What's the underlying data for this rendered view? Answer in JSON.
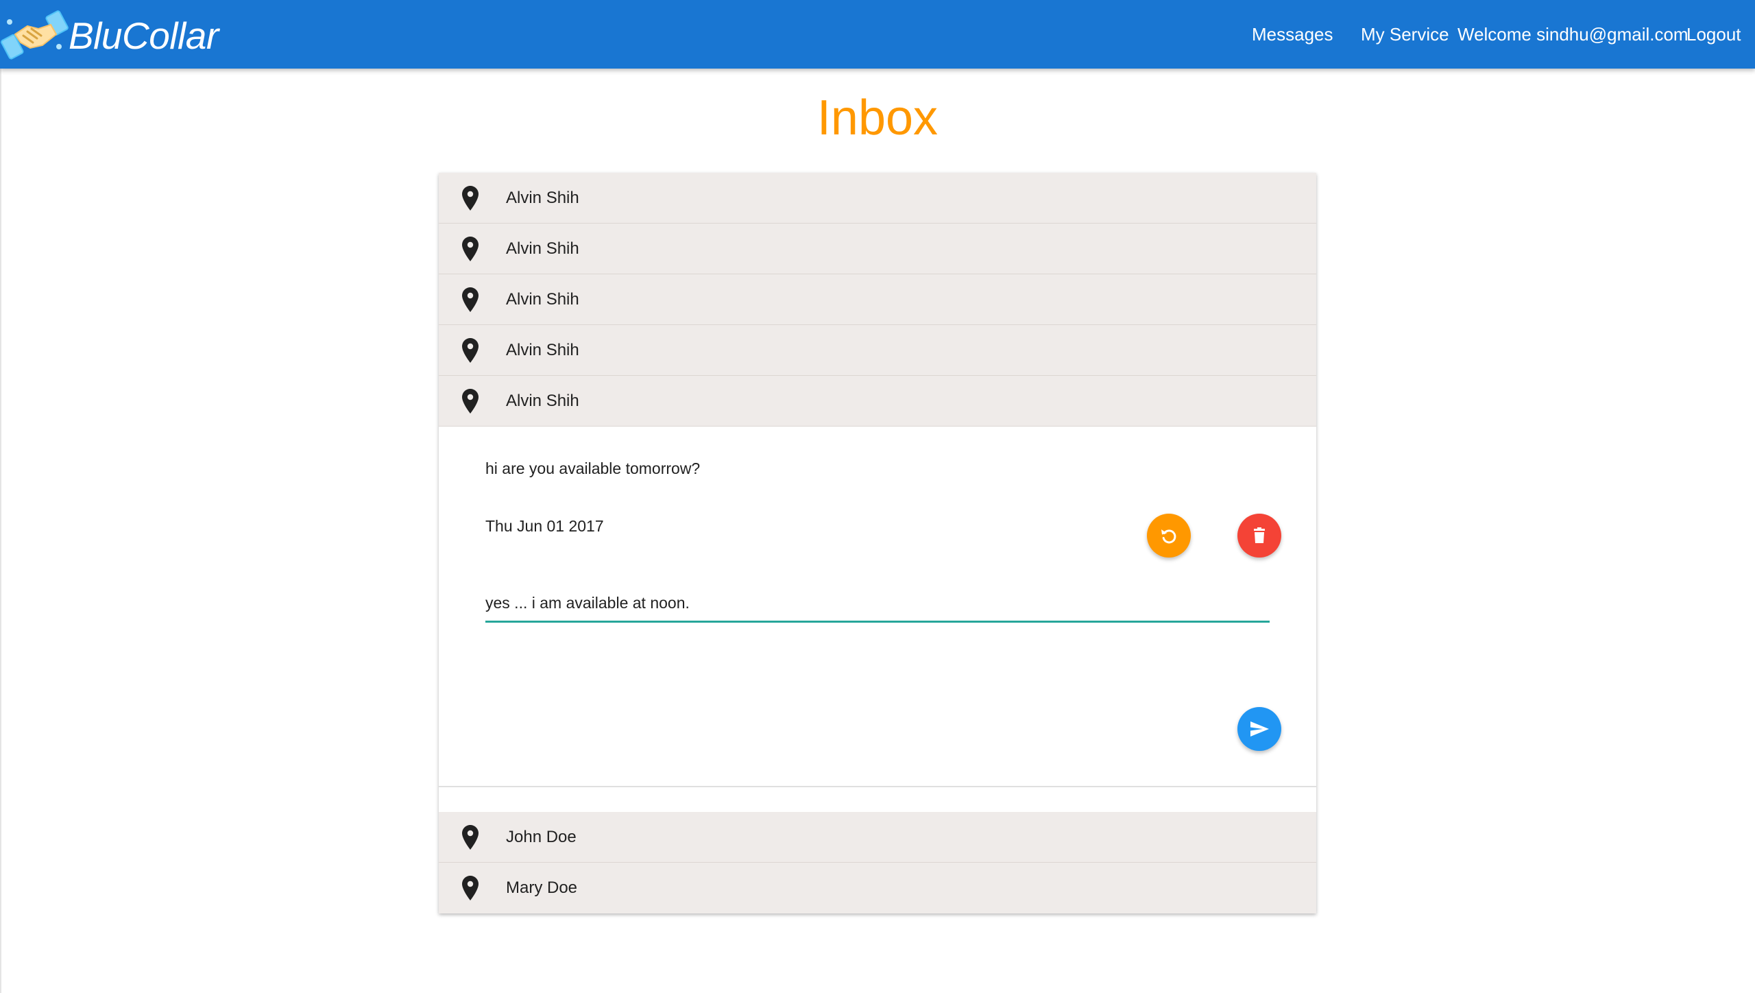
{
  "appbar": {
    "brand": "BluCollar",
    "nav": {
      "messages": "Messages",
      "my_service": "My Service",
      "welcome": "Welcome sindhu@gmail.com",
      "logout": "Logout"
    },
    "background": "#1976d2"
  },
  "page": {
    "title": "Inbox",
    "title_color": "#ff9800"
  },
  "inbox": {
    "conversations": [
      {
        "name": "Alvin Shih",
        "icon": "location-pin-icon"
      },
      {
        "name": "Alvin Shih",
        "icon": "location-pin-icon"
      },
      {
        "name": "Alvin Shih",
        "icon": "location-pin-icon"
      },
      {
        "name": "Alvin Shih",
        "icon": "location-pin-icon"
      },
      {
        "name": "Alvin Shih",
        "icon": "location-pin-icon"
      },
      {
        "name": "John Doe",
        "icon": "location-pin-icon"
      },
      {
        "name": "Mary Doe",
        "icon": "location-pin-icon"
      }
    ],
    "open_message": {
      "body": "hi are you available tomorrow?",
      "date": "Thu Jun 01 2017",
      "reply_value": "yes ... i am available at noon.",
      "actions": [
        {
          "name": "undo",
          "icon": "undo-icon",
          "color": "#ff9800"
        },
        {
          "name": "delete",
          "icon": "trash-icon",
          "color": "#f44336"
        },
        {
          "name": "send",
          "icon": "send-icon",
          "color": "#2196f3"
        }
      ],
      "input_underline_color": "#26a69a"
    }
  }
}
